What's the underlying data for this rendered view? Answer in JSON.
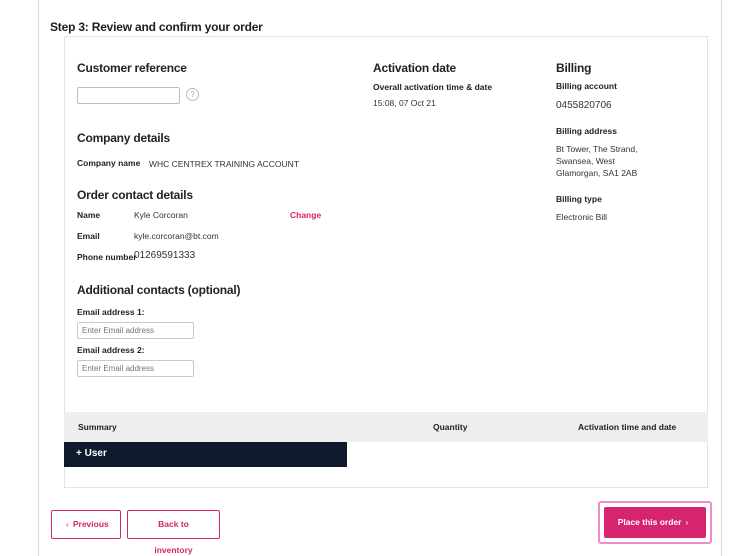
{
  "step_title": "Step 3: Review and confirm your order",
  "customer_reference": {
    "heading": "Customer reference",
    "value": "",
    "help_icon": "question-circle-icon"
  },
  "company_details": {
    "heading": "Company details",
    "name_label": "Company name",
    "name_value": "WHC CENTREX TRAINING ACCOUNT"
  },
  "order_contact": {
    "heading": "Order contact details",
    "name_label": "Name",
    "name_value": "Kyle Corcoran",
    "change_label": "Change",
    "email_label": "Email",
    "email_value": "kyle.corcoran@bt.com",
    "phone_label": "Phone number",
    "phone_value": "01269591333"
  },
  "additional_contacts": {
    "heading": "Additional contacts (optional)",
    "email1_label": "Email address 1:",
    "email1_placeholder": "Enter Email address",
    "email2_label": "Email address 2:",
    "email2_placeholder": "Enter Email address"
  },
  "activation": {
    "heading": "Activation date",
    "sub_label": "Overall activation time & date",
    "value": "15:08, 07 Oct 21"
  },
  "billing": {
    "heading": "Billing",
    "account_label": "Billing account",
    "account_value": "0455820706",
    "address_label": "Billing address",
    "address_line1": "Bt Tower, The Strand,",
    "address_line2": "Swansea, West",
    "address_line3": "Glamorgan, SA1 2AB",
    "type_label": "Billing type",
    "type_value": "Electronic Bill"
  },
  "summary": {
    "col_summary": "Summary",
    "col_quantity": "Quantity",
    "col_activation": "Activation time and date",
    "row_label": "+ User"
  },
  "buttons": {
    "previous": "Previous",
    "back": "Back to inventory",
    "place_order": "Place this order"
  },
  "colors": {
    "accent": "#d6246e",
    "dark_row": "#0e1a2b",
    "focus_ring": "#f08ad0"
  }
}
